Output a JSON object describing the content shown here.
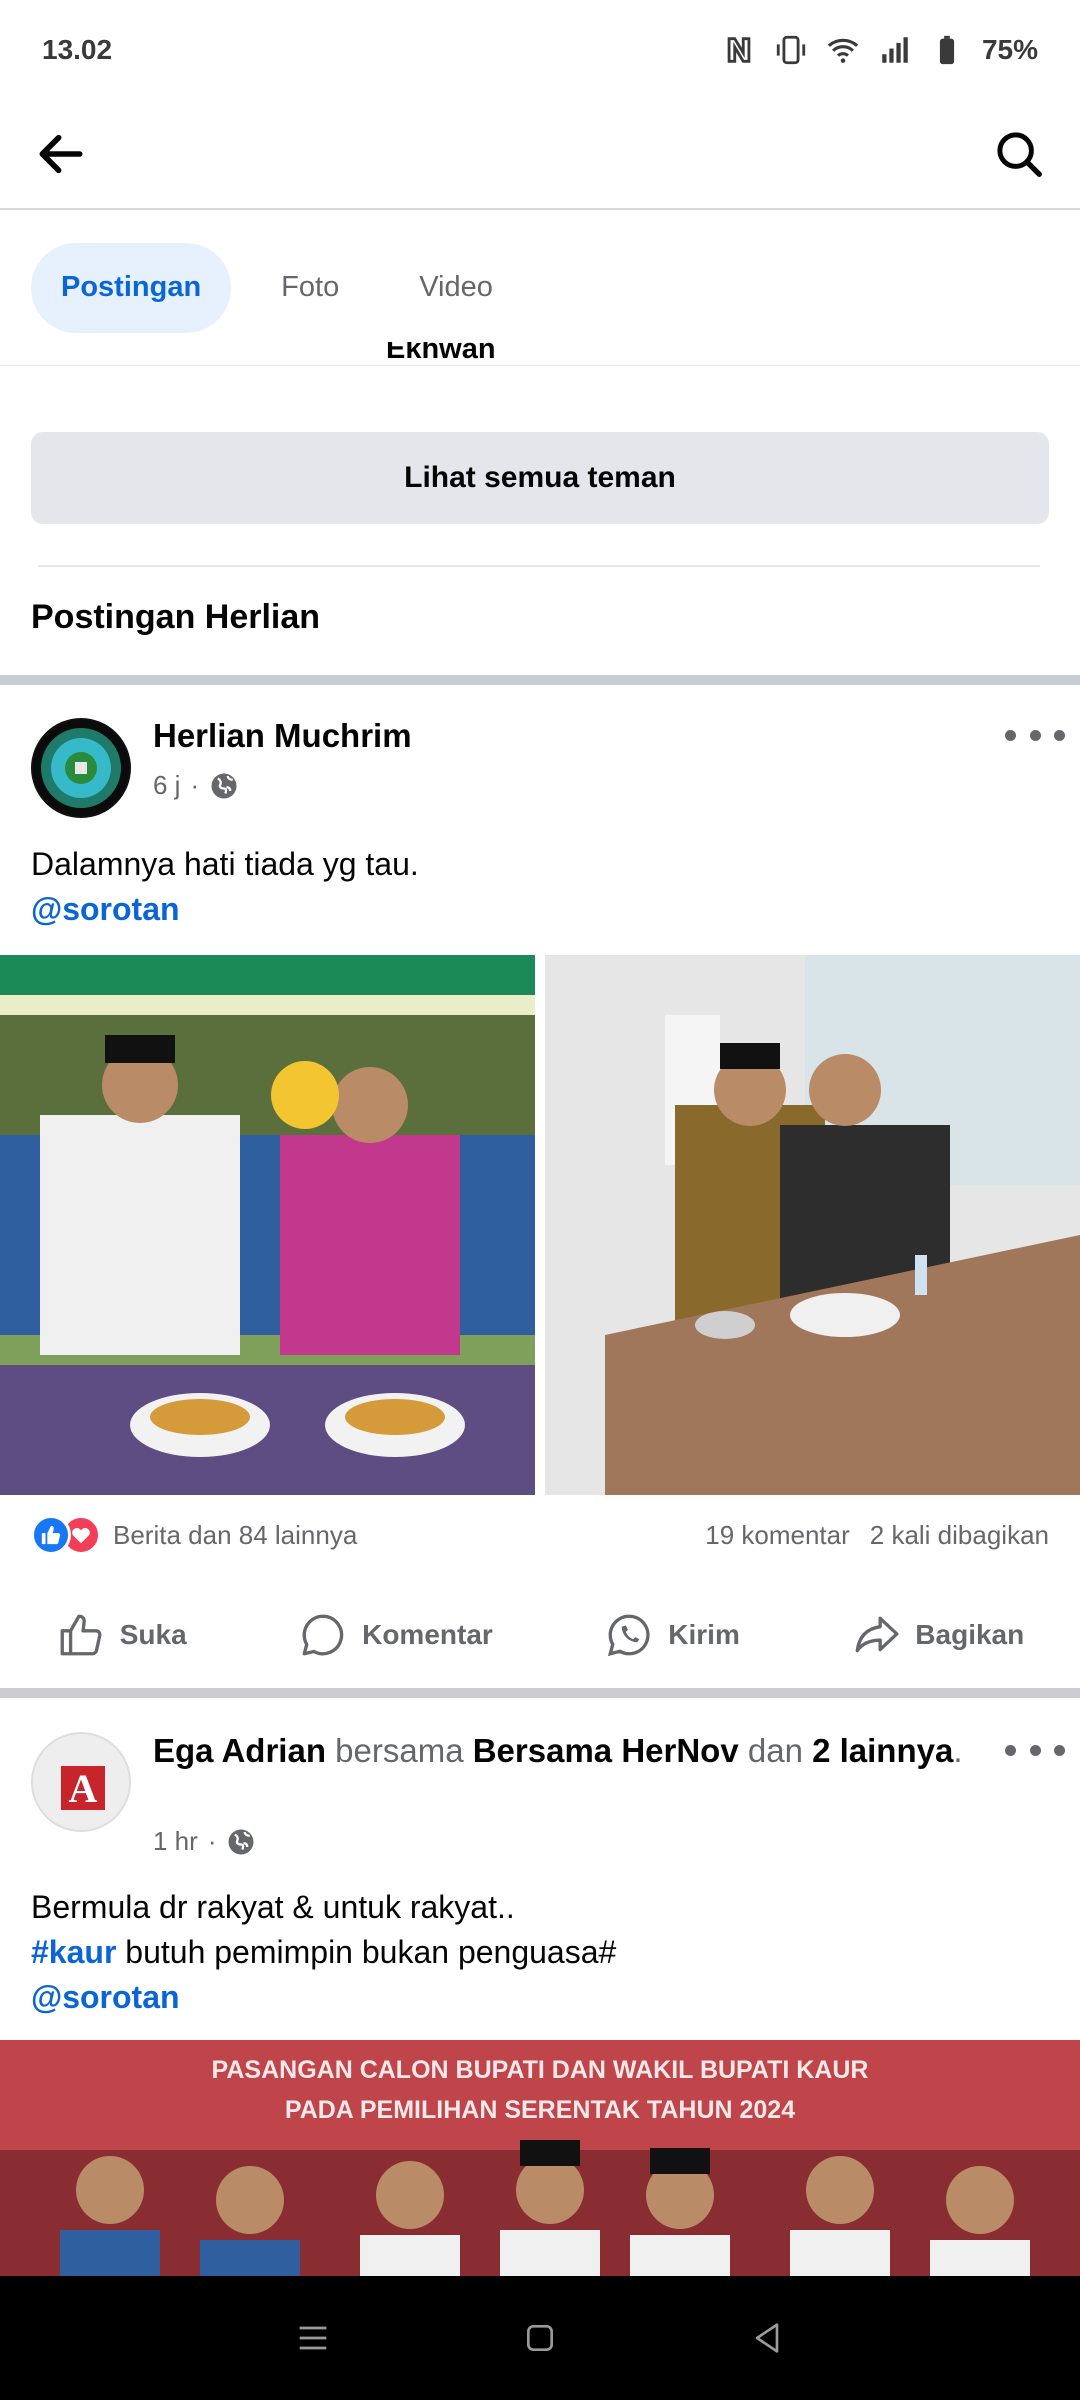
{
  "status_bar": {
    "time": "13.02",
    "battery": "75%",
    "icons": [
      "nfc-icon",
      "vibrate-icon",
      "wifi-icon",
      "signal-icon",
      "battery-icon"
    ]
  },
  "header": {
    "back_icon": "back-arrow-icon",
    "search_icon": "search-icon"
  },
  "tabs": [
    {
      "label": "Postingan",
      "active": true
    },
    {
      "label": "Foto",
      "active": false
    },
    {
      "label": "Video",
      "active": false
    }
  ],
  "friends": {
    "partial_name": "Ekhwan",
    "see_all_label": "Lihat semua teman"
  },
  "section_title": "Postingan Herlian",
  "post1": {
    "author": "Herlian Muchrim",
    "time": "6 j",
    "privacy_icon": "globe-icon",
    "text": "Dalamnya hati tiada yg tau.",
    "mention": "@sorotan",
    "reactions_text": "Berita dan 84 lainnya",
    "comments": "19 komentar",
    "shares": "2 kali dibagikan"
  },
  "actions": {
    "like": "Suka",
    "comment": "Komentar",
    "send": "Kirim",
    "share": "Bagikan"
  },
  "post2": {
    "author": "Ega Adrian",
    "with_word": "bersama",
    "tagged": "Bersama HerNov",
    "and_word": "dan",
    "others": "2 lainnya",
    "period": ".",
    "time": "1 hr",
    "line1": "Bermula dr rakyat & untuk rakyat..",
    "hashtag": "#kaur",
    "line2_rest": " butuh pemimpin bukan penguasa#",
    "mention": "@sorotan",
    "banner_line1": "PASANGAN CALON BUPATI DAN WAKIL BUPATI KAUR",
    "banner_line2": "PADA PEMILIHAN SERENTAK TAHUN 2024"
  },
  "colors": {
    "accent": "#0a66d8",
    "tab_active_bg": "#e7f0fd",
    "muted": "#65676b",
    "button_bg": "#e4e6eb",
    "like_blue": "#1877f2",
    "love_red": "#f33e58"
  }
}
